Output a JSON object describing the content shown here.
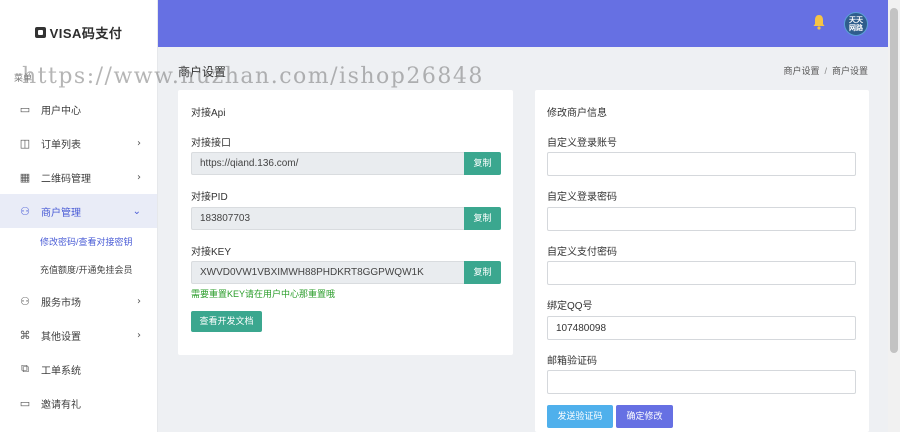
{
  "brand": {
    "name": "VISA码支付"
  },
  "sidebar": {
    "caption": "菜单",
    "items": [
      {
        "label": "用户中心",
        "icon": "monitor-icon"
      },
      {
        "label": "订单列表",
        "icon": "list-icon"
      },
      {
        "label": "二维码管理",
        "icon": "qrcode-icon"
      },
      {
        "label": "商户管理",
        "icon": "users-icon"
      },
      {
        "label": "服务市场",
        "icon": "users-icon"
      },
      {
        "label": "其他设置",
        "icon": "command-icon"
      },
      {
        "label": "工单系统",
        "icon": "external-icon"
      },
      {
        "label": "邀请有礼",
        "icon": "monitor-icon"
      }
    ],
    "sub_items": [
      {
        "label": "修改密码/查看对接密钥"
      },
      {
        "label": "充值额度/开通免挂会员"
      }
    ]
  },
  "topbar": {
    "avatar_line1": "天天",
    "avatar_line2": "网路"
  },
  "watermark": "https://www.huzhan.com/ishop26848",
  "page": {
    "title": "商户设置",
    "breadcrumb": [
      "商户设置",
      "商户设置"
    ]
  },
  "api_card": {
    "title": "对接Api",
    "fields": [
      {
        "label": "对接接口",
        "value": "https://qiand.136.com/",
        "button": "复制"
      },
      {
        "label": "对接PID",
        "value": "183807703",
        "button": "复制"
      },
      {
        "label": "对接KEY",
        "value": "XWVD0VW1VBXIMWH88PHDKRT8GGPWQW1K",
        "button": "复制"
      }
    ],
    "notice": "需要重置KEY请在用户中心那重置哦",
    "doc_button": "查看开发文档"
  },
  "edit_card": {
    "title": "修改商户信息",
    "fields": [
      {
        "label": "自定义登录账号",
        "value": ""
      },
      {
        "label": "自定义登录密码",
        "value": ""
      },
      {
        "label": "自定义支付密码",
        "value": ""
      },
      {
        "label": "绑定QQ号",
        "value": "107480098"
      },
      {
        "label": "邮箱验证码",
        "value": ""
      }
    ],
    "send_button": "发送验证码",
    "confirm_button": "确定修改"
  },
  "colors": {
    "accent": "#6670e3",
    "copy": "#3ba78f",
    "send": "#4fb0ec",
    "notice": "#2a9d2a"
  }
}
